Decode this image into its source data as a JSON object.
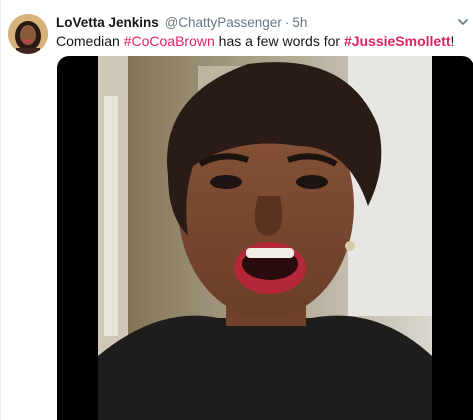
{
  "tweet": {
    "author_name": "LoVetta Jenkins",
    "author_handle": "@ChattyPassenger",
    "separator": "·",
    "time": "5h",
    "text_prefix": "Comedian ",
    "hashtag_1": "#CoCoaBrown",
    "text_middle": " has a few words for ",
    "hashtag_2": "#JussieSmollett",
    "text_suffix": "!"
  },
  "icons": {
    "menu": "chevron-down-icon"
  },
  "colors": {
    "hashtag": "#e0245e",
    "name": "#14171a",
    "meta": "#657786",
    "background": "#ffffff"
  }
}
